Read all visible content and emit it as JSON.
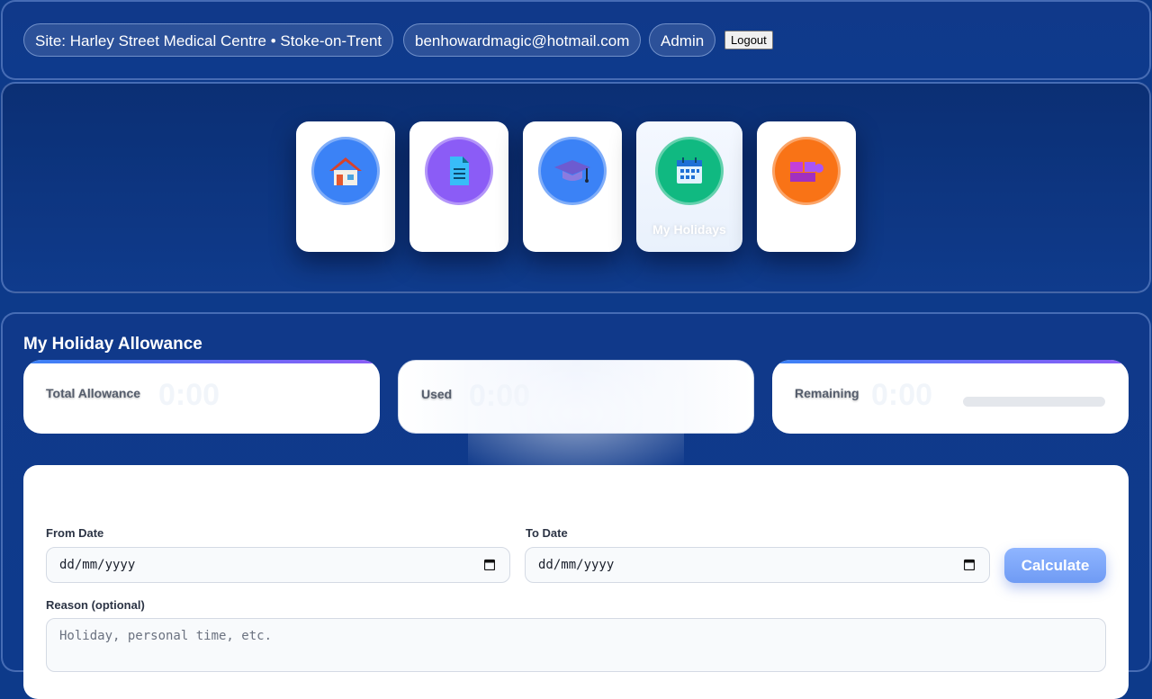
{
  "header": {
    "site": "Site: Harley Street Medical Centre • Stoke-on-Trent",
    "email": "benhowardmagic@hotmail.com",
    "role": "Admin",
    "logout_label": "Logout"
  },
  "nav": {
    "cards": [
      {
        "icon": "house-icon",
        "label": "",
        "color": "#3b82f6"
      },
      {
        "icon": "document-icon",
        "label": "",
        "color": "#8b5cf6"
      },
      {
        "icon": "graduation-cap-icon",
        "label": "",
        "color": "#3b82f6"
      },
      {
        "icon": "calendar-icon",
        "label": "My Holidays",
        "color": "#10b981"
      },
      {
        "icon": "puzzle-icon",
        "label": "",
        "color": "#f97316"
      }
    ]
  },
  "main": {
    "title": "My Holiday Allowance",
    "stats": [
      {
        "label": "Total Allowance",
        "value": "0:00"
      },
      {
        "label": "Used",
        "value": "0:00"
      },
      {
        "label": "Remaining",
        "value": "0:00"
      }
    ],
    "form": {
      "from_label": "From Date",
      "from_value": "dd/mm/yyyy",
      "to_label": "To Date",
      "to_value": "dd/mm/yyyy",
      "calculate_label": "Calculate",
      "reason_label": "Reason (optional)",
      "reason_placeholder": "Holiday, personal time, etc."
    }
  }
}
